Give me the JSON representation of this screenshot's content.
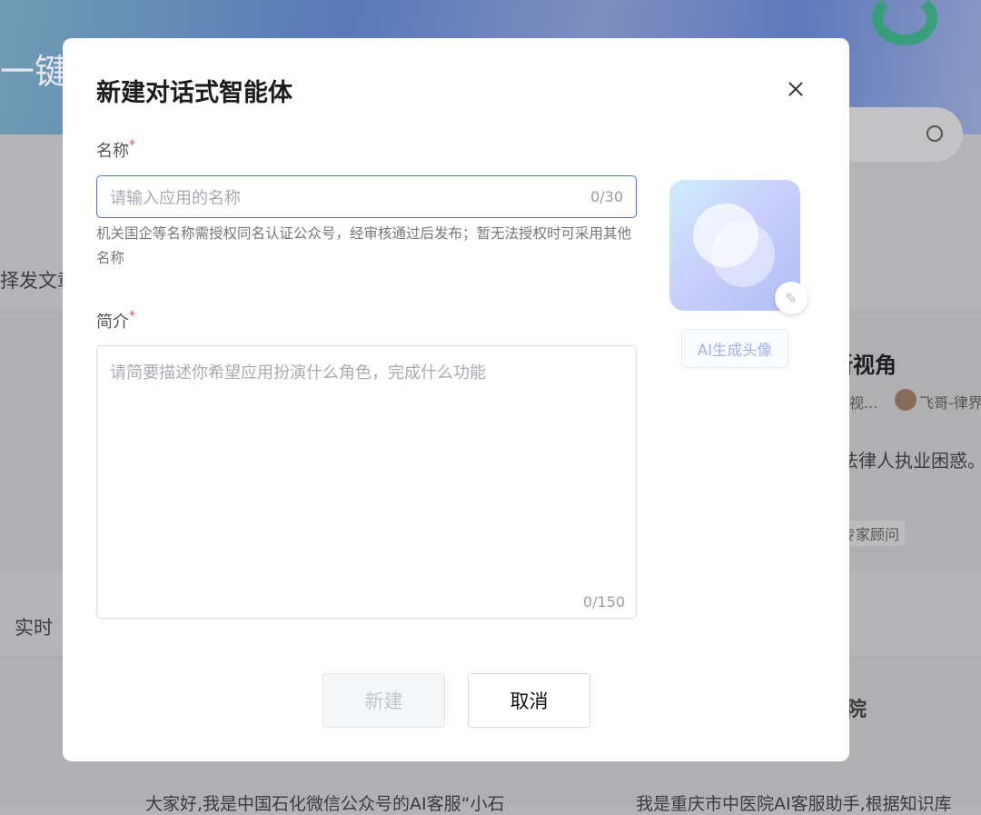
{
  "background": {
    "banner_text": "一键",
    "left_text_1": "择发文章",
    "left_text_2": "实时",
    "card_title": "新视角",
    "card_meta_1": "视...",
    "card_author": "飞哥-律界",
    "card_desc": "法律人执业困惑。",
    "card_tag": "专家顾问",
    "card2_title": "院",
    "bottom_text_1": "大家好,我是中国石化微信公众号的AI客服“小石",
    "bottom_text_2": "我是重庆市中医院AI客服助手,根据知识库"
  },
  "modal": {
    "title": "新建对话式智能体",
    "name_label": "名称",
    "required_mark": "*",
    "name_placeholder": "请输入应用的名称",
    "name_count": "0/30",
    "name_hint": "机关国企等名称需授权同名认证公众号，经审核通过后发布；暂无法授权时可采用其他名称",
    "intro_label": "简介",
    "intro_placeholder": "请简要描述你希望应用扮演什么角色，完成什么功能",
    "intro_count": "0/150",
    "ai_avatar_button": "AI生成头像",
    "create_button": "新建",
    "cancel_button": "取消"
  }
}
